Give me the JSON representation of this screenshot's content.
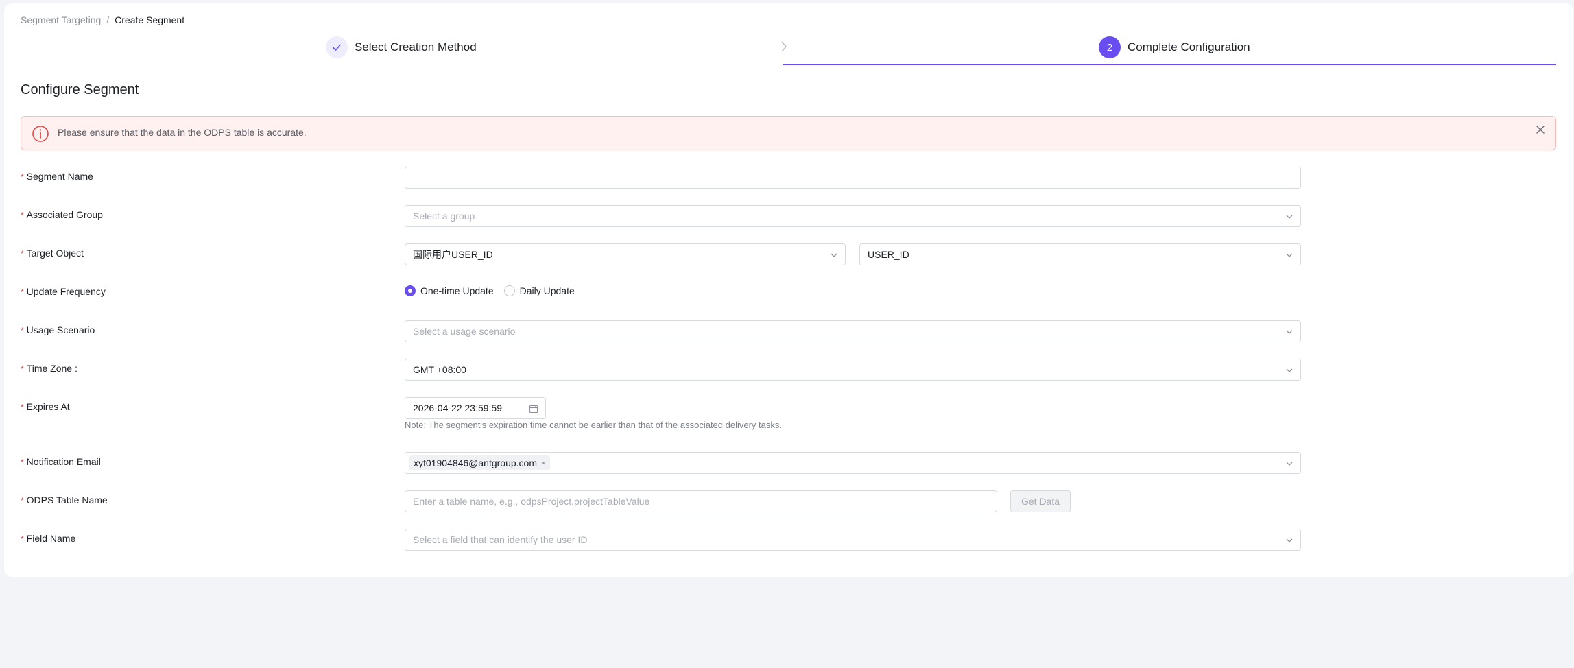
{
  "breadcrumb": {
    "parent": "Segment Targeting",
    "separator": "/",
    "current": "Create Segment"
  },
  "steps": {
    "step1": {
      "label": "Select Creation Method",
      "status": "done"
    },
    "step2": {
      "number": "2",
      "label": "Complete Configuration",
      "status": "active"
    }
  },
  "section_title": "Configure Segment",
  "alert": {
    "text": "Please ensure that the data in the ODPS table is accurate."
  },
  "form": {
    "required_mark": "*",
    "segment_name": {
      "label": "Segment Name",
      "value": ""
    },
    "associated_group": {
      "label": "Associated Group",
      "placeholder": "Select a group"
    },
    "target_object": {
      "label": "Target Object",
      "value_left": "国际用户USER_ID",
      "value_right": "USER_ID"
    },
    "update_frequency": {
      "label": "Update Frequency",
      "options": [
        "One-time Update",
        "Daily Update"
      ],
      "selected": "One-time Update"
    },
    "usage_scenario": {
      "label": "Usage Scenario",
      "placeholder": "Select a usage scenario"
    },
    "time_zone": {
      "label": "Time Zone :",
      "value": "GMT +08:00"
    },
    "expires_at": {
      "label": "Expires At",
      "value": "2026-04-22 23:59:59",
      "note": "Note: The segment's expiration time cannot be earlier than that of the associated delivery tasks."
    },
    "notification_email": {
      "label": "Notification Email",
      "tags": [
        "xyf01904846@antgroup.com"
      ],
      "remove_glyph": "×"
    },
    "odps_table_name": {
      "label": "ODPS Table Name",
      "placeholder": "Enter a table name, e.g., odpsProject.projectTableValue",
      "button": "Get Data"
    },
    "field_name": {
      "label": "Field Name",
      "placeholder": "Select a field that can identify the user ID"
    }
  },
  "colors": {
    "accent": "#6a4df0",
    "required": "#e54545",
    "alert_bg": "#fff1f0",
    "alert_border": "#f6bcbc"
  }
}
